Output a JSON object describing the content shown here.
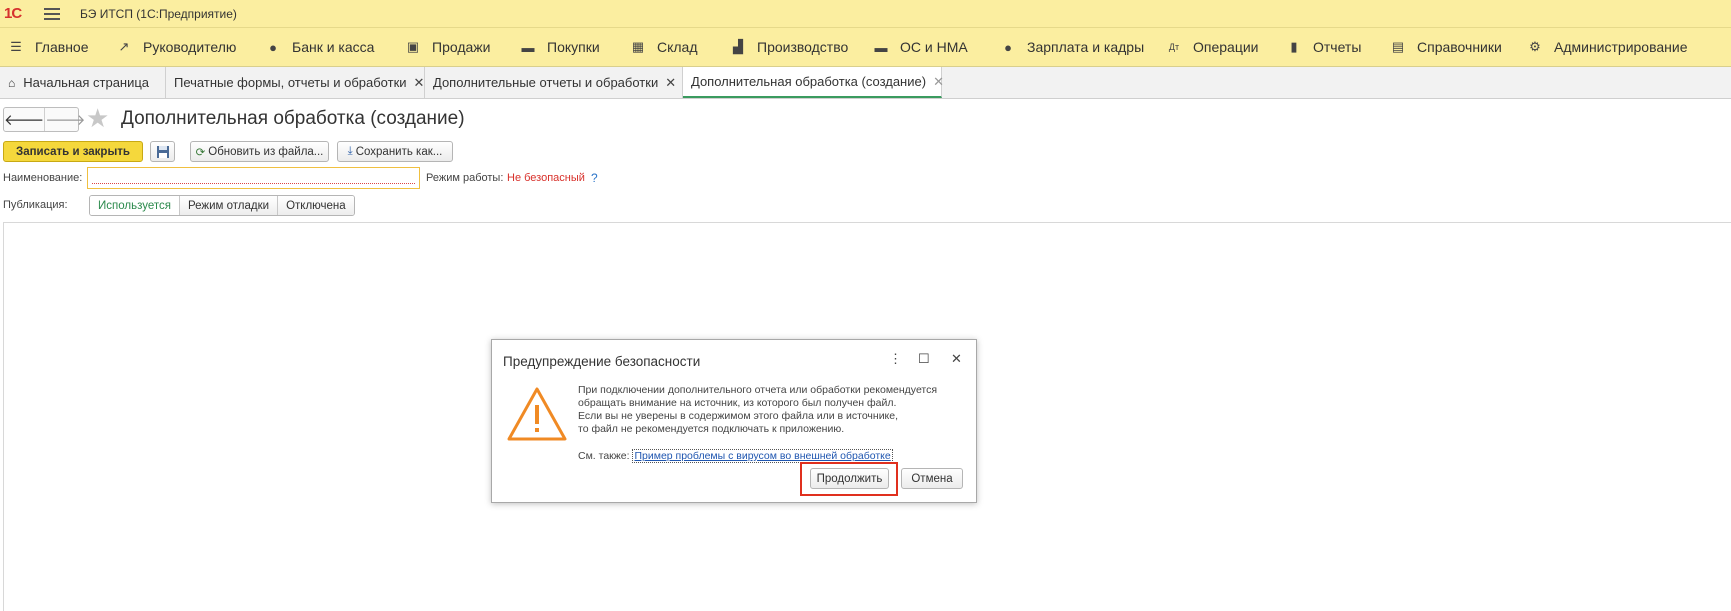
{
  "titlebar": {
    "logo": "1С",
    "app_title": "БЭ ИТСП  (1С:Предприятие)"
  },
  "sections": [
    {
      "label": "Главное",
      "icon": "menu-icon"
    },
    {
      "label": "Руководителю",
      "icon": "trend-icon"
    },
    {
      "label": "Банк и касса",
      "icon": "coin-icon"
    },
    {
      "label": "Продажи",
      "icon": "bag-icon"
    },
    {
      "label": "Покупки",
      "icon": "cart-icon"
    },
    {
      "label": "Склад",
      "icon": "warehouse-icon"
    },
    {
      "label": "Производство",
      "icon": "factory-icon"
    },
    {
      "label": "ОС и НМА",
      "icon": "truck-icon"
    },
    {
      "label": "Зарплата и кадры",
      "icon": "person-icon"
    },
    {
      "label": "Операции",
      "icon": "dt-kt-icon"
    },
    {
      "label": "Отчеты",
      "icon": "bar-chart-icon"
    },
    {
      "label": "Справочники",
      "icon": "books-icon"
    },
    {
      "label": "Администрирование",
      "icon": "gear-icon"
    }
  ],
  "tabs": [
    {
      "label": "Начальная страница"
    },
    {
      "label": "Печатные формы, отчеты и обработки"
    },
    {
      "label": "Дополнительные отчеты и обработки"
    },
    {
      "label": "Дополнительная обработка (создание)"
    }
  ],
  "form": {
    "title": "Дополнительная обработка (создание)",
    "save_close": "Записать и закрыть",
    "update_from_file": "Обновить из файла...",
    "save_as": "Сохранить как...",
    "name_label": "Наименование:",
    "name_value": "",
    "mode_label": "Режим работы:",
    "mode_value": "Не безопасный",
    "help": "?",
    "publication_label": "Публикация:",
    "publication_options": [
      "Используется",
      "Режим отладки",
      "Отключена"
    ]
  },
  "dialog": {
    "title": "Предупреждение безопасности",
    "message_lines": [
      "При подключении дополнительного отчета или обработки рекомендуется",
      "обращать внимание на источник, из которого был получен файл.",
      "Если вы не уверены в содержимом этого файла или в источнике,",
      "то файл не рекомендуется подключать к приложению."
    ],
    "see_also": "См. также:",
    "link": "Пример проблемы с вирусом во внешней обработке",
    "continue": "Продолжить",
    "cancel": "Отмена"
  },
  "colors": {
    "header_bg": "#fbeea0",
    "primary_button": "#f5d83c",
    "warning": "#f08a24",
    "danger_text": "#d8302a",
    "highlight": "#e0301e"
  }
}
